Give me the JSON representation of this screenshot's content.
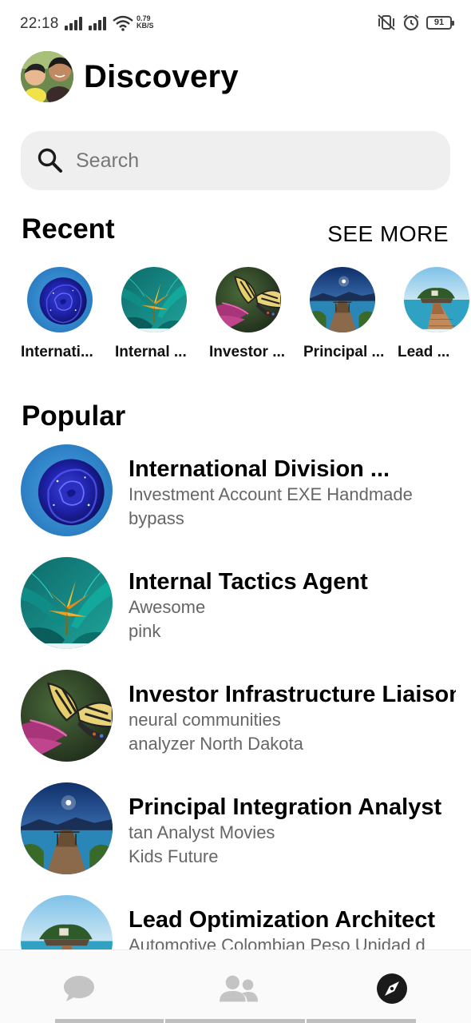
{
  "status_bar": {
    "time": "22:18",
    "speed_value": "0.79",
    "speed_unit": "KB/S",
    "battery": "91",
    "icons": [
      "signal-icon",
      "signal-icon",
      "wifi-icon",
      "vibrate-icon",
      "alarm-icon",
      "battery-icon"
    ]
  },
  "header": {
    "title": "Discovery",
    "avatar_icon": "profile-avatar"
  },
  "search": {
    "placeholder": "Search",
    "icon": "search-icon"
  },
  "recent": {
    "title": "Recent",
    "see_more": "SEE MORE",
    "items": [
      {
        "label": "Internati...",
        "image": "blue-rose"
      },
      {
        "label": "Internal ...",
        "image": "bird-of-paradise-flower"
      },
      {
        "label": "Investor ...",
        "image": "butterfly-on-flower"
      },
      {
        "label": "Principal ...",
        "image": "lake-pier-night"
      },
      {
        "label": "Lead ...",
        "image": "island-boardwalk"
      }
    ]
  },
  "popular": {
    "title": "Popular",
    "items": [
      {
        "name": "International Division ...",
        "line1": "Investment Account EXE Handmade",
        "line2": "bypass",
        "image": "blue-rose"
      },
      {
        "name": "Internal Tactics Agent",
        "line1": "Awesome",
        "line2": "pink",
        "image": "bird-of-paradise-flower"
      },
      {
        "name": "Investor Infrastructure Liaison",
        "line1": "neural communities",
        "line2": "analyzer North Dakota",
        "image": "butterfly-on-flower"
      },
      {
        "name": "Principal Integration Analyst",
        "line1": "tan Analyst Movies",
        "line2": "Kids Future",
        "image": "lake-pier-night"
      },
      {
        "name": "Lead Optimization Architect",
        "line1": "Automotive Colombian Peso Unidad d",
        "line2": "",
        "image": "island-boardwalk"
      }
    ]
  },
  "bottom_nav": {
    "items": [
      {
        "icon": "chat-bubble-icon",
        "active": false
      },
      {
        "icon": "people-icon",
        "active": false
      },
      {
        "icon": "compass-icon",
        "active": true
      }
    ]
  },
  "colors": {
    "search_bg": "#efefef",
    "subtitle_text": "#666666",
    "nav_icon_inactive": "#c4c4c4",
    "nav_icon_active": "#1a1a1a"
  }
}
